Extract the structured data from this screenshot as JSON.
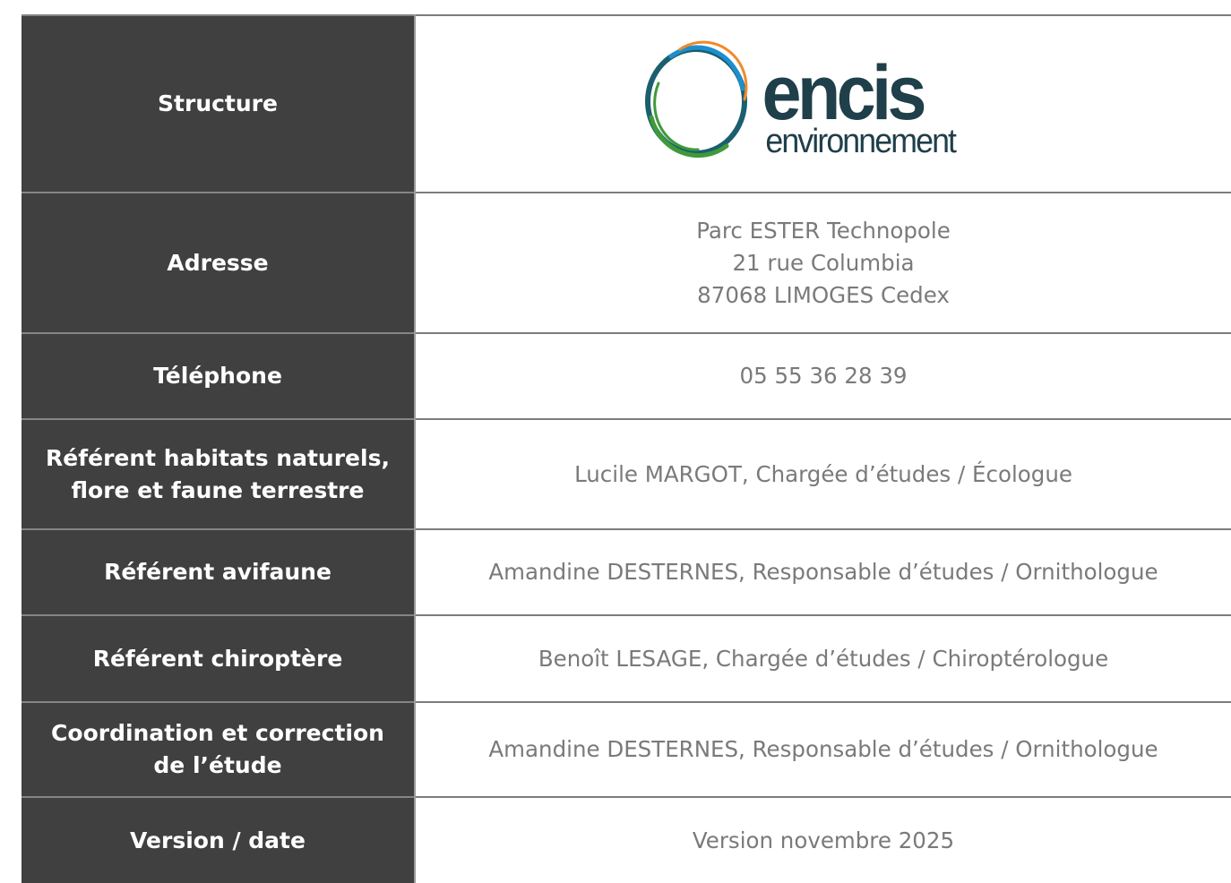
{
  "rows": [
    {
      "label": "Structure",
      "logo": {
        "word": "encis",
        "subword": "environnement",
        "colors": {
          "text": "#1f3f4a",
          "ring_green": "#3f9a3a",
          "ring_blue": "#1d8fd0",
          "ring_orange": "#f08a2a",
          "ring_teal": "#1b5f6e"
        }
      }
    },
    {
      "label": "Adresse",
      "lines": [
        "Parc ESTER Technopole",
        "21 rue Columbia",
        "87068 LIMOGES Cedex"
      ]
    },
    {
      "label": "Téléphone",
      "value": "05 55 36 28 39"
    },
    {
      "label": "Référent habitats naturels, flore et faune terrestre",
      "value": "Lucile MARGOT, Chargée d’études / Écologue"
    },
    {
      "label": "Référent avifaune",
      "value": "Amandine DESTERNES, Responsable d’études / Ornithologue"
    },
    {
      "label": "Référent chiroptère",
      "value": "Benoît LESAGE, Chargée d’études / Chiroptérologue"
    },
    {
      "label": "Coordination et correction de l’étude",
      "value": "Amandine DESTERNES, Responsable d’études / Ornithologue"
    },
    {
      "label": "Version / date",
      "value": "Version novembre 2025"
    }
  ],
  "colors": {
    "label_bg": "#404040",
    "label_text": "#ffffff",
    "value_text": "#7a7a7a",
    "rule": "#7c7c7c"
  }
}
